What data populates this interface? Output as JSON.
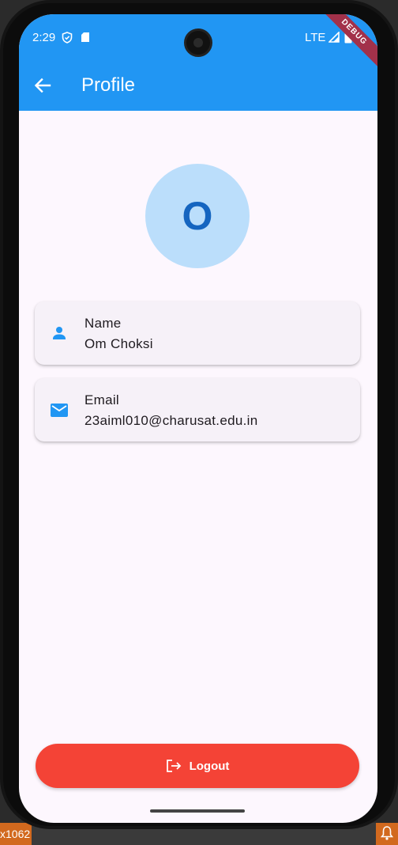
{
  "status_bar": {
    "time": "2:29",
    "network": "LTE",
    "debug_label": "DEBUG"
  },
  "appbar": {
    "title": "Profile",
    "color": "#2196f3"
  },
  "avatar": {
    "initial": "O"
  },
  "cards": [
    {
      "icon": "person-icon",
      "label": "Name",
      "value": "Om Choksi"
    },
    {
      "icon": "mail-icon",
      "label": "Email",
      "value": "23aiml010@charusat.edu.in"
    }
  ],
  "logout": {
    "label": "Logout",
    "color": "#f44336"
  },
  "host": {
    "left_text": "x1062"
  }
}
